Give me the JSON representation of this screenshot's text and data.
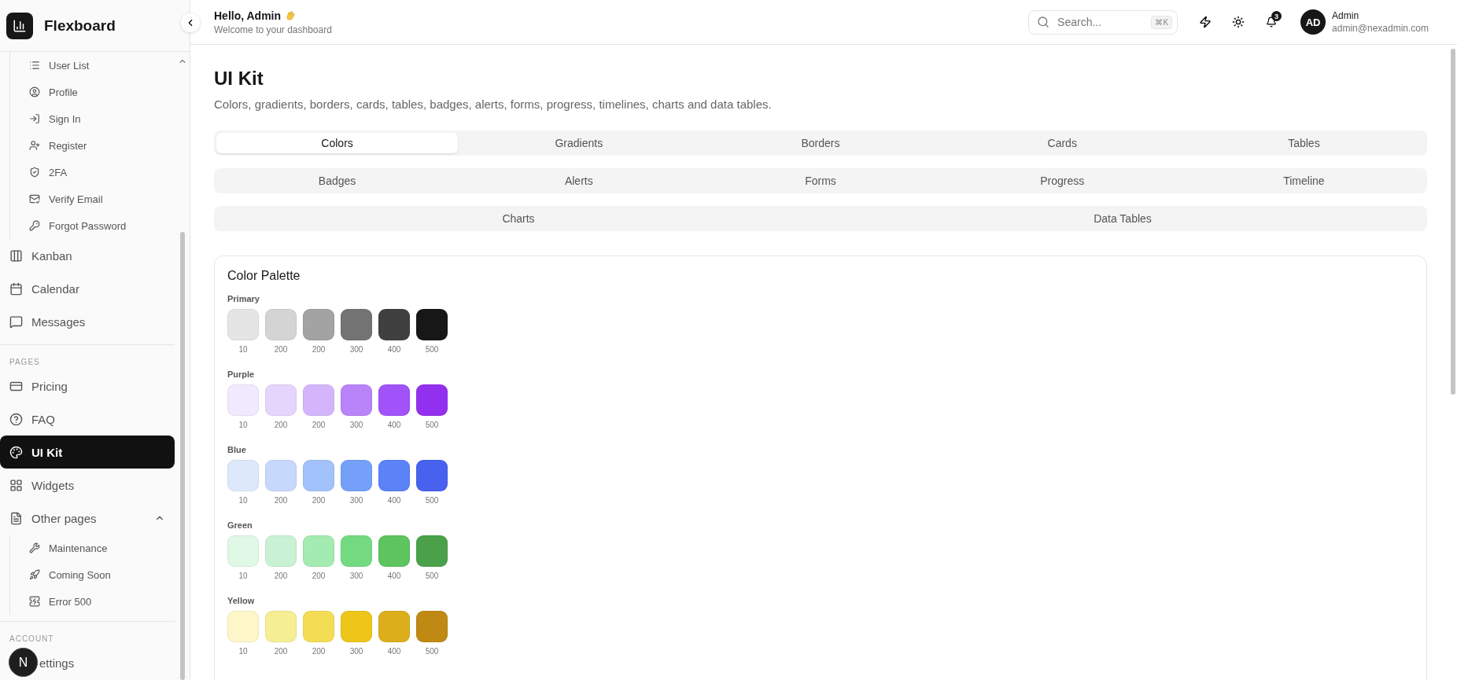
{
  "sidebar": {
    "brand": "Flexboard",
    "sections": [
      {
        "nested_items": [
          {
            "label": "User List",
            "selected": false
          },
          {
            "label": "Profile",
            "selected": false
          },
          {
            "label": "Sign In",
            "selected": false
          },
          {
            "label": "Register",
            "selected": false
          },
          {
            "label": "2FA",
            "selected": false
          },
          {
            "label": "Verify Email",
            "selected": false
          },
          {
            "label": "Forgot Password",
            "selected": false
          }
        ],
        "items": [
          {
            "label": "Kanban",
            "selected": false
          },
          {
            "label": "Calendar",
            "selected": false
          },
          {
            "label": "Messages",
            "selected": false
          }
        ]
      },
      {
        "label": "PAGES",
        "items": [
          {
            "label": "Pricing",
            "selected": false
          },
          {
            "label": "FAQ",
            "selected": false
          },
          {
            "label": "UI Kit",
            "selected": true
          },
          {
            "label": "Widgets",
            "selected": false
          },
          {
            "label": "Other pages",
            "selected": false,
            "expanded": true,
            "children": [
              {
                "label": "Maintenance",
                "selected": false
              },
              {
                "label": "Coming Soon",
                "selected": false
              },
              {
                "label": "Error 500",
                "selected": false
              }
            ]
          }
        ]
      },
      {
        "label": "ACCOUNT",
        "items": [
          {
            "label": "ettings",
            "selected": false,
            "kind": "partly_hidden"
          }
        ]
      }
    ],
    "floating_badge": "N"
  },
  "header": {
    "greeting": "Hello, Admin",
    "subtitle": "Welcome to your dashboard",
    "search": {
      "placeholder": "Search...",
      "shortcut": "⌘K"
    },
    "notifications": "3",
    "user": {
      "initials": "AD",
      "name": "Admin",
      "email": "admin@nexadmin.com"
    }
  },
  "page": {
    "title": "UI Kit",
    "subtitle": "Colors, gradients, borders, cards, tables, badges, alerts, forms, progress, timelines, charts and data tables."
  },
  "tab_rows": [
    [
      {
        "label": "Colors",
        "selected": true
      },
      {
        "label": "Gradients",
        "selected": false
      },
      {
        "label": "Borders",
        "selected": false
      },
      {
        "label": "Cards",
        "selected": false
      },
      {
        "label": "Tables",
        "selected": false
      }
    ],
    [
      {
        "label": "Badges",
        "selected": false
      },
      {
        "label": "Alerts",
        "selected": false
      },
      {
        "label": "Forms",
        "selected": false
      },
      {
        "label": "Progress",
        "selected": false
      },
      {
        "label": "Timeline",
        "selected": false
      }
    ],
    [
      {
        "label": "Charts",
        "selected": false
      },
      {
        "label": "Data Tables",
        "selected": false
      }
    ]
  ],
  "palette": {
    "title": "Color Palette",
    "groups": [
      {
        "name": "Primary",
        "swatches": [
          {
            "label": "10",
            "color": "#e5e5e5"
          },
          {
            "label": "200",
            "color": "#d4d4d4"
          },
          {
            "label": "200",
            "color": "#a3a3a3"
          },
          {
            "label": "300",
            "color": "#737373"
          },
          {
            "label": "400",
            "color": "#404040"
          },
          {
            "label": "500",
            "color": "#171717"
          }
        ]
      },
      {
        "name": "Purple",
        "swatches": [
          {
            "label": "10",
            "color": "#f1e9fe"
          },
          {
            "label": "200",
            "color": "#e5d5fd"
          },
          {
            "label": "200",
            "color": "#d4b5fc"
          },
          {
            "label": "300",
            "color": "#b983fa"
          },
          {
            "label": "400",
            "color": "#a152f8"
          },
          {
            "label": "500",
            "color": "#9330f0"
          }
        ]
      },
      {
        "name": "Blue",
        "swatches": [
          {
            "label": "10",
            "color": "#dde8fb"
          },
          {
            "label": "200",
            "color": "#c6d8fc"
          },
          {
            "label": "200",
            "color": "#a1c2fb"
          },
          {
            "label": "300",
            "color": "#74a0f9"
          },
          {
            "label": "400",
            "color": "#5b82f7"
          },
          {
            "label": "500",
            "color": "#4861ee"
          }
        ]
      },
      {
        "name": "Green",
        "swatches": [
          {
            "label": "10",
            "color": "#e0f8e6"
          },
          {
            "label": "200",
            "color": "#c8f2d3"
          },
          {
            "label": "200",
            "color": "#a3ebb0"
          },
          {
            "label": "300",
            "color": "#74da82"
          },
          {
            "label": "400",
            "color": "#5dc45f"
          },
          {
            "label": "500",
            "color": "#4ba14a"
          }
        ]
      },
      {
        "name": "Yellow",
        "swatches": [
          {
            "label": "10",
            "color": "#fcf6c8"
          },
          {
            "label": "200",
            "color": "#f6ee92"
          },
          {
            "label": "200",
            "color": "#f3dd55"
          },
          {
            "label": "300",
            "color": "#edc619"
          },
          {
            "label": "400",
            "color": "#dcae1c"
          },
          {
            "label": "500",
            "color": "#bf8914"
          }
        ]
      }
    ]
  }
}
